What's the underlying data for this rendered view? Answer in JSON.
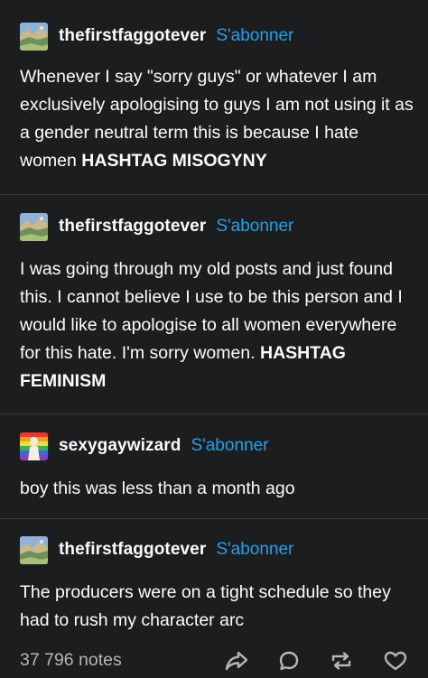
{
  "posts": [
    {
      "username": "thefirstfaggotever",
      "follow_label": "S'abonner",
      "avatar_icon": "landscape-painting-avatar",
      "text": "Whenever I say \"sorry guys\" or whatever I am exclusively apologising to guys I am not using it as a gender neutral term this is because I hate women ",
      "tag": "HASHTAG MISOGYNY"
    },
    {
      "username": "thefirstfaggotever",
      "follow_label": "S'abonner",
      "avatar_icon": "landscape-painting-avatar",
      "text": "I was going through my old posts and just found this. I cannot believe I use to be this person and I would like to apologise to all women everywhere for this hate. I'm sorry women. ",
      "tag": "HASHTAG FEMINISM"
    },
    {
      "username": "sexygaywizard",
      "follow_label": "S'abonner",
      "avatar_icon": "rainbow-figure-avatar",
      "text": "boy this was less than a month ago",
      "tag": ""
    },
    {
      "username": "thefirstfaggotever",
      "follow_label": "S'abonner",
      "avatar_icon": "landscape-painting-avatar",
      "text": "The producers were on a tight schedule so they had to rush my character arc",
      "tag": ""
    }
  ],
  "footer": {
    "notes": "37 796 notes",
    "icons": [
      "share-icon",
      "reply-icon",
      "reblog-icon",
      "like-icon"
    ]
  },
  "colors": {
    "background": "#1c1d1f",
    "text": "#ffffff",
    "follow": "#1fa1e8",
    "muted": "#b5b6b8"
  }
}
